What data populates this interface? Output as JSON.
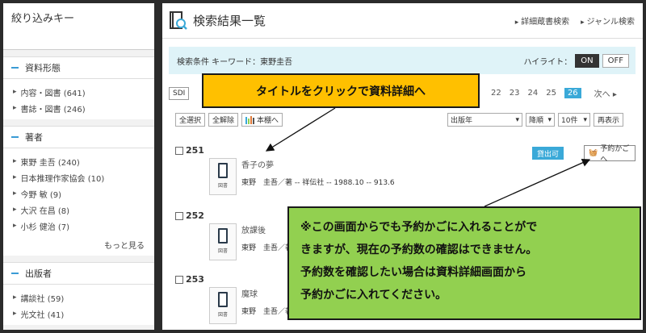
{
  "left": {
    "filter_title": "絞り込みキー",
    "sections": [
      {
        "title": "資料形態",
        "items": [
          "内容・図書 (641)",
          "書誌・図書 (246)"
        ]
      },
      {
        "title": "著者",
        "items": [
          "東野 圭吾 (240)",
          "日本推理作家協会 (10)",
          "今野 敏 (9)",
          "大沢 在昌 (8)",
          "小杉 健治 (7)"
        ],
        "more": "もっと見る"
      },
      {
        "title": "出版者",
        "items": [
          "講談社 (59)",
          "光文社 (41)"
        ]
      }
    ]
  },
  "header": {
    "title": "検索結果一覧",
    "links": [
      "詳細蔵書検索",
      "ジャンル検索"
    ]
  },
  "condition": {
    "text": "検索条件  キーワード：東野圭吾",
    "highlight_label": "ハイライト：",
    "on": "ON",
    "off": "OFF"
  },
  "sdi": "SDI",
  "pagination": {
    "pages": [
      "22",
      "23",
      "24",
      "25"
    ],
    "current": "26",
    "next": "次へ ▸"
  },
  "toolbar": {
    "select_all": "全選択",
    "deselect_all": "全解除",
    "shelf": "本棚へ"
  },
  "sort": {
    "field": "出版年",
    "order": "降順",
    "count": "10件",
    "redisplay": "再表示"
  },
  "results": [
    {
      "num": "251",
      "title": "香子の夢",
      "author": "東野　圭吾／著 -- 祥伝社 -- 1988.10 -- 913.6",
      "status": "貸出可",
      "cart": "予約かごへ",
      "thumb": "図書"
    },
    {
      "num": "252",
      "title": "放課後",
      "author": "東野　圭吾／著",
      "thumb": "図書"
    },
    {
      "num": "253",
      "title": "魔球",
      "author": "東野　圭吾／著",
      "thumb": "図書"
    }
  ],
  "callouts": {
    "c1": "タイトルをクリックで資料詳細へ",
    "c2": [
      "※この画面からでも予約かごに入れることがで",
      "きますが、現在の予約数の確認はできません。",
      "予約数を確認したい場合は資料詳細画面から",
      "予約かごに入れてください。"
    ]
  },
  "colors": {
    "accent": "#3aa9d8",
    "callout_orange": "#ffc000",
    "callout_green": "#92d050"
  }
}
